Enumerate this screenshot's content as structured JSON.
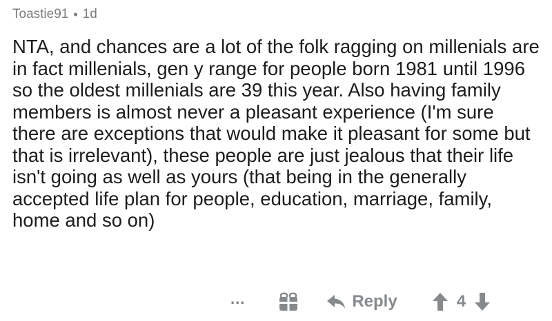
{
  "comment": {
    "username": "Toastie91",
    "separator": "•",
    "age": "1d",
    "body": "NTA, and chances are a lot of the folk ragging on millenials are in fact millenials, gen y range for people born 1981 until 1996 so the oldest millenials are 39 this year. Also having family members is almost never a pleasant experience (I'm sure there are exceptions that would make it pleasant for some but that is irrelevant), these people are just jealous that their life isn't going as well as yours (that being in the generally accepted life plan for people, education, marriage, family, home and so on)"
  },
  "actions": {
    "more_label": "...",
    "reply_label": "Reply",
    "score": "4"
  },
  "icons": {
    "more": "more-dots-icon",
    "award": "gift-award-icon",
    "reply": "reply-arrow-icon",
    "upvote": "upvote-arrow-icon",
    "downvote": "downvote-arrow-icon"
  },
  "colors": {
    "meta_text": "#7c7c7c",
    "body_text": "#1c1c1c",
    "action_gray": "#878a8c"
  }
}
